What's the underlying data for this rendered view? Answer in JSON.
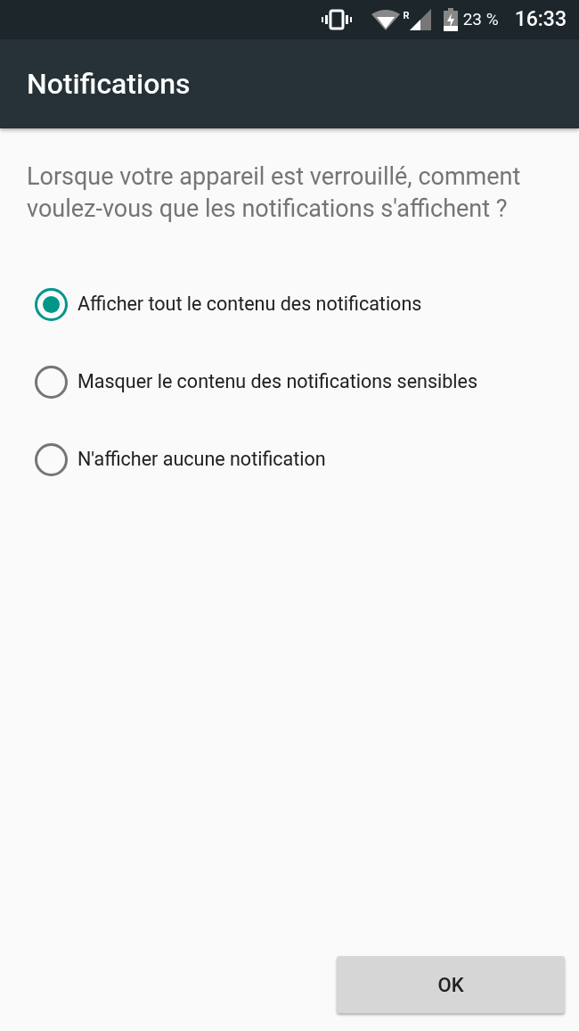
{
  "status_bar": {
    "roaming": "R",
    "battery": "23 %",
    "time": "16:33"
  },
  "app_bar": {
    "title": "Notifications"
  },
  "question": "Lorsque votre appareil est verrouillé, comment voulez-vous que les notifications s'affichent ?",
  "options": [
    {
      "label": "Afficher tout le contenu des notifications",
      "selected": true
    },
    {
      "label": "Masquer le contenu des notifications sensibles",
      "selected": false
    },
    {
      "label": "N'afficher aucune notification",
      "selected": false
    }
  ],
  "buttons": [
    "OK"
  ]
}
